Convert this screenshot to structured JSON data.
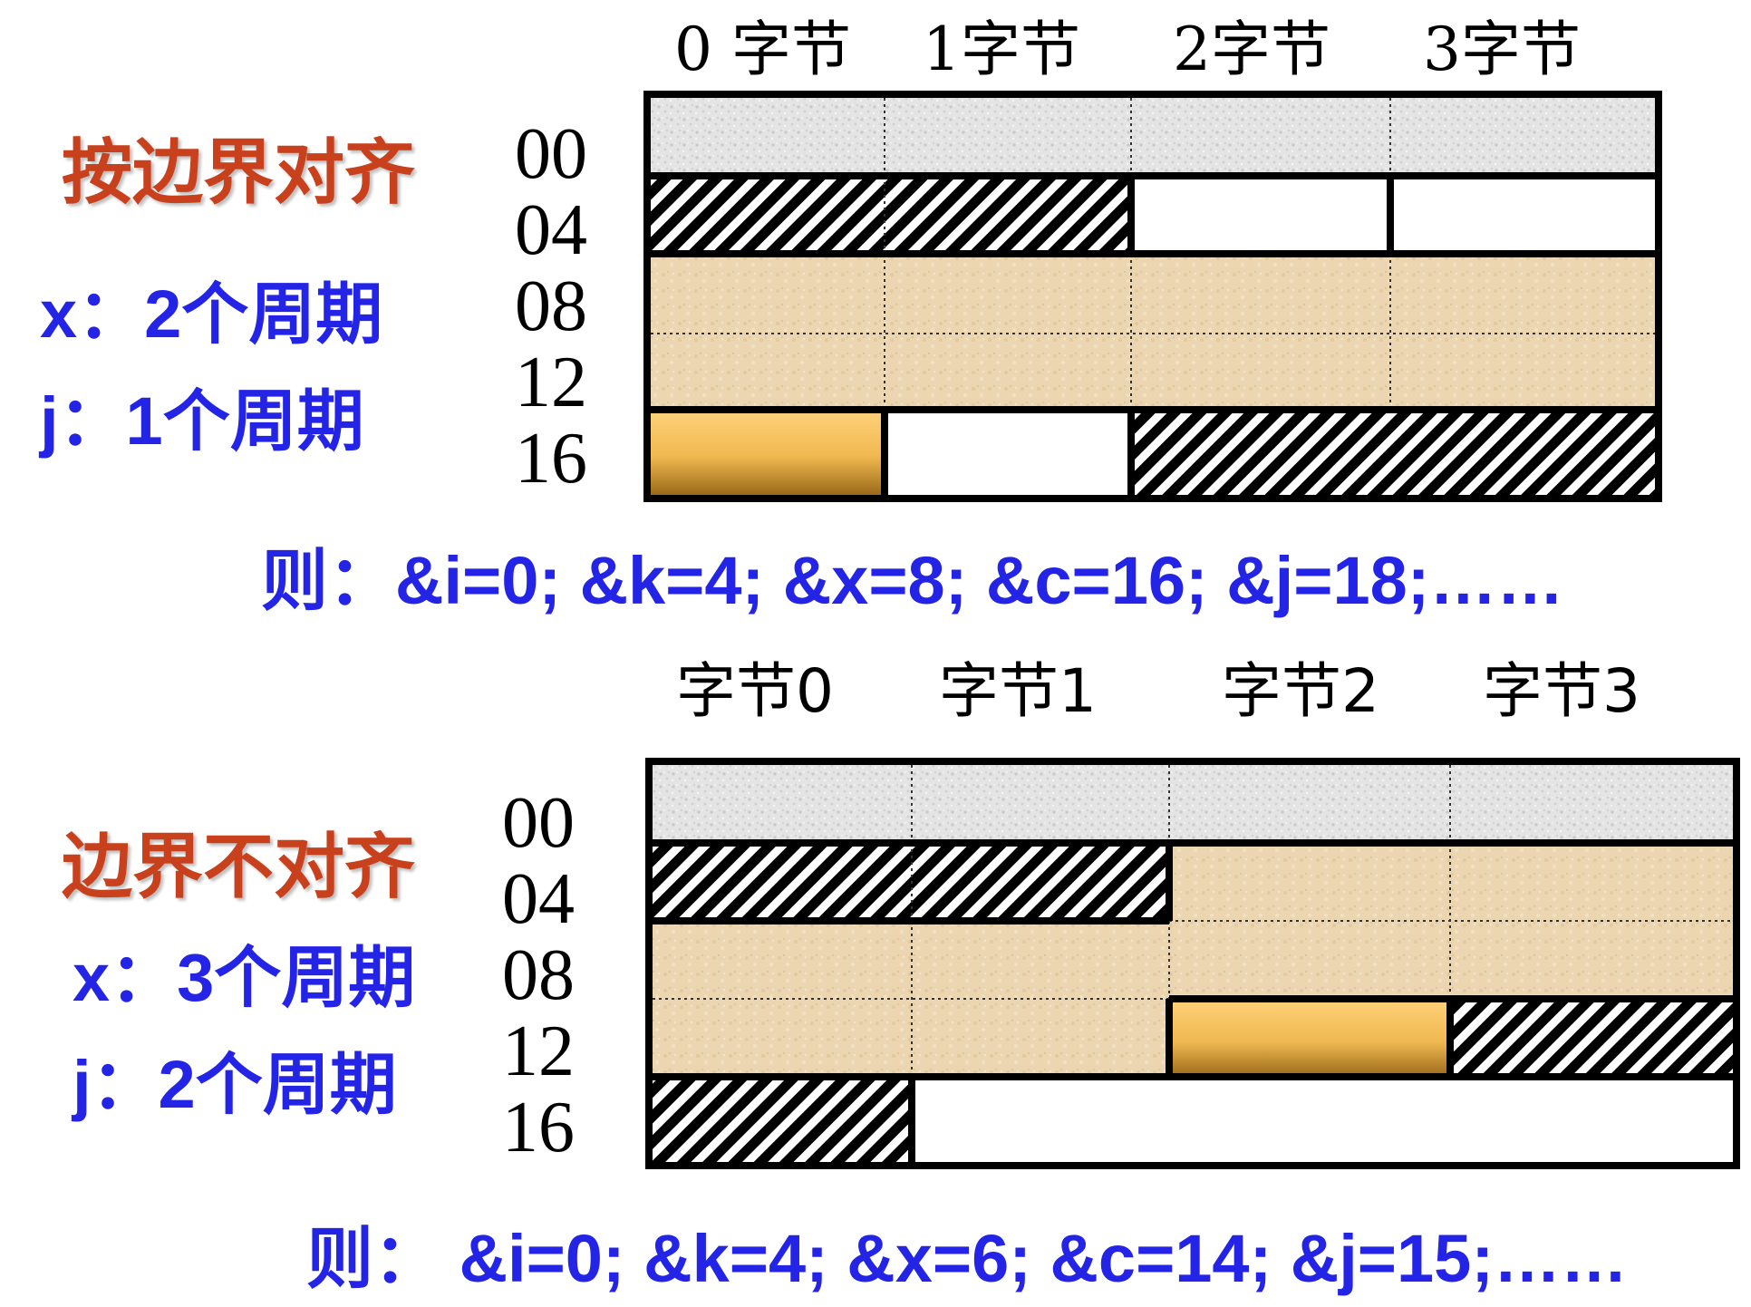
{
  "top": {
    "heading": "按边界对齐",
    "cycles": [
      "x：2个周期",
      "j：1个周期"
    ],
    "col_headers": [
      "0 字节",
      "1字节",
      "2字节",
      "3字节"
    ],
    "row_labels": [
      "00",
      "04",
      "08",
      "12",
      "16"
    ],
    "result_prefix": "则：",
    "result_text": "&i=0; &k=4; &x=8; &c=16; &j=18;……"
  },
  "bottom": {
    "heading": "边界不对齐",
    "cycles": [
      "x：3个周期",
      "j：2个周期"
    ],
    "col_headers": [
      "字节0",
      "字节1",
      "字节2",
      "字节3"
    ],
    "row_labels": [
      "00",
      "04",
      "08",
      "12",
      "16"
    ],
    "result_prefix": "则：",
    "result_text": "&i=0; &k=4; &x=6; &c=14; &j=15;……"
  },
  "colors": {
    "heading": "#c8401c",
    "blue_text": "#2424e6",
    "gray_fill": "#dcdcdc",
    "tan_fill": "#ecd6b2",
    "gold_fill": "#f2c25a"
  }
}
